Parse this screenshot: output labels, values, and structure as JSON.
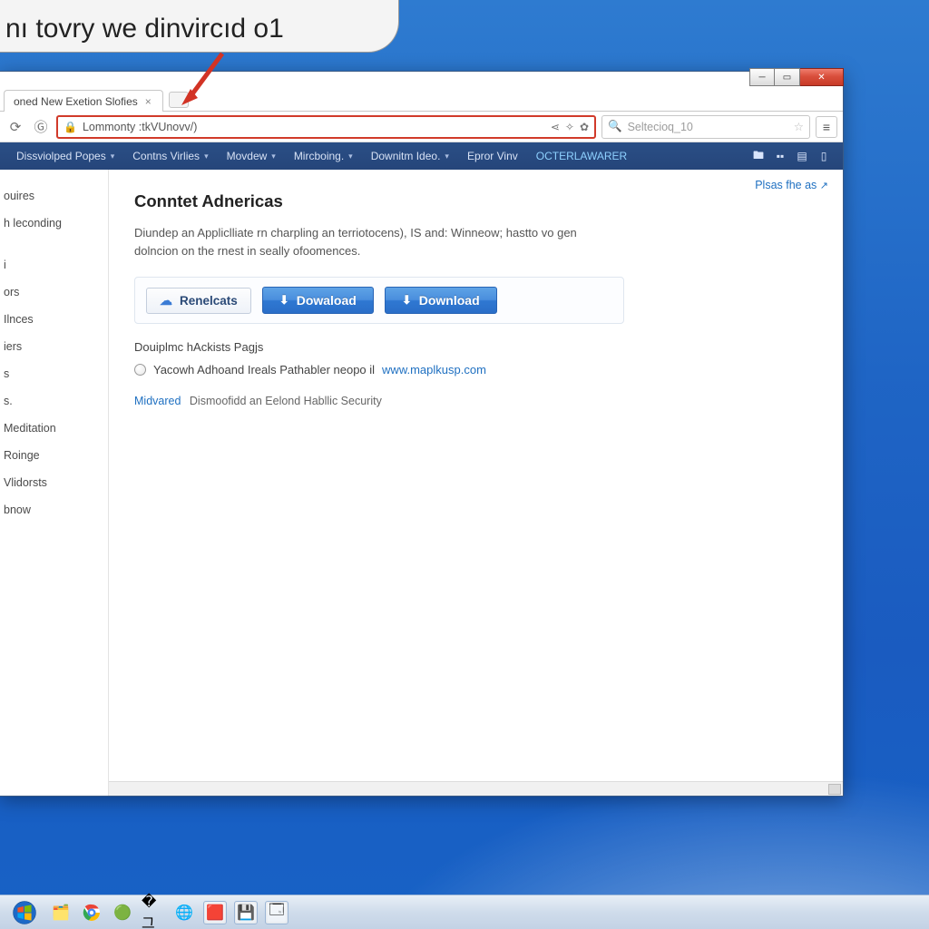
{
  "callout_text": "nı tovry we dinvircıd o1",
  "tab": {
    "title": "oned New Exetion Slofies"
  },
  "url": "Lommonty :tkVUnovv/)",
  "search_placeholder": "Seltecioq_10",
  "navbar": {
    "items": [
      "Dissviolped Popes",
      "Contns Virlies",
      "Movdew",
      "Mircboing.",
      "Downitm Ideo.",
      "Epror Vinv"
    ],
    "highlight": "OCTERLAWARER"
  },
  "sidebar": {
    "items": [
      "ouires",
      "h leconding",
      "",
      "i",
      "ors",
      "Ilnces",
      "iers",
      "s",
      "s.",
      " Meditation",
      " Roinge",
      " Vlidorsts",
      "bnow"
    ]
  },
  "share_label": "Plsas fhe as",
  "page": {
    "title": "Conntet Adnericas",
    "desc_line1": "Diundep an Appliclliate rn charpling an terriotocens), IS and: Winneow; hastto vo gen",
    "desc_line2": "dolncion on the rnest in seally ofoomences.",
    "chip_label": "Renelcats",
    "download1": "Dowaload",
    "download2": "Download",
    "subhead": "Douiplmc hAckists Pagjs",
    "radio_text": "Yacowh Adhoand Ireals Pathabler neopo il",
    "radio_link_text": "www.maplkusp.com",
    "foot_tag": "Midvared",
    "foot_rest": "Dismoofidd an Eelond Habllic Security"
  },
  "taskbar": {
    "clock": ""
  }
}
